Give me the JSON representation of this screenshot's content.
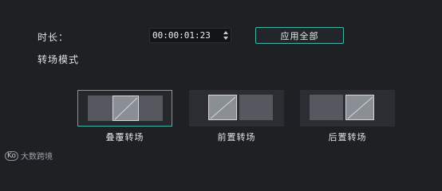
{
  "duration": {
    "label": "时长：",
    "value": "00:00:01:23"
  },
  "apply_all_label": "应用全部",
  "mode_label": "转场模式",
  "modes": [
    {
      "label": "叠覆转场",
      "selected": true
    },
    {
      "label": "前置转场",
      "selected": false
    },
    {
      "label": "后置转场",
      "selected": false
    }
  ],
  "colors": {
    "accent": "#3fb7a6",
    "background": "#1f2024"
  },
  "watermark": {
    "logo": "Ko",
    "text": "大数跨境"
  }
}
